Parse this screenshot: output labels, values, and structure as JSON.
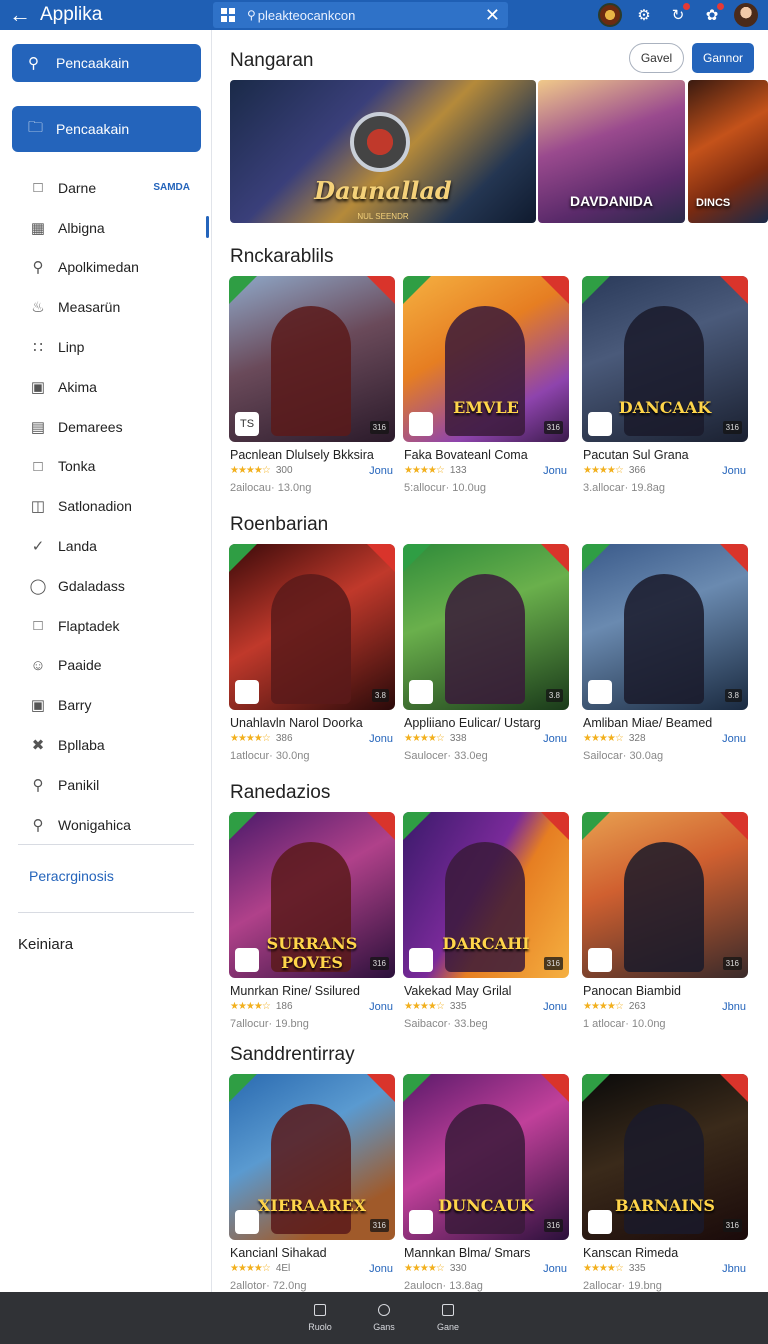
{
  "topbar": {
    "back_icon": "arrow-left-icon",
    "title": "Applika",
    "search_value": "pleakteocankcon"
  },
  "sidebar": {
    "primary_button": "Pencaakain",
    "secondary_button": "Pencaakain",
    "items": [
      {
        "label": "Darne",
        "icon": "bag-icon",
        "tag": "SAMDA"
      },
      {
        "label": "Albigna",
        "icon": "calendar-icon"
      },
      {
        "label": "Apolkimedan",
        "icon": "wrench-icon"
      },
      {
        "label": "Measarün",
        "icon": "puzzle-icon"
      },
      {
        "label": "Linp",
        "icon": "grid-dots-icon"
      },
      {
        "label": "Akima",
        "icon": "frame-icon"
      },
      {
        "label": "Demarees",
        "icon": "folder-icon"
      },
      {
        "label": "Tonka",
        "icon": "tag-icon"
      },
      {
        "label": "Satlonadion",
        "icon": "columns-icon"
      },
      {
        "label": "Landa",
        "icon": "check-icon"
      },
      {
        "label": "Gdaladass",
        "icon": "pill-icon"
      },
      {
        "label": "Flaptadek",
        "icon": "square-icon"
      },
      {
        "label": "Paaide",
        "icon": "person-icon"
      },
      {
        "label": "Barry",
        "icon": "lock-icon"
      },
      {
        "label": "Bpllaba",
        "icon": "tools-icon"
      },
      {
        "label": "Panikil",
        "icon": "search-icon"
      },
      {
        "label": "Wonigahica",
        "icon": "search-icon"
      }
    ],
    "link": "Peracrginosis",
    "section": "Keiniara"
  },
  "main": {
    "header_title": "Nangaran",
    "outline_button": "Gavel",
    "solid_button": "Gannor",
    "banners": [
      {
        "label": "Daunallad",
        "sub": "NUL SEENDR"
      },
      {
        "label": "DAVDANIDA",
        "sub": ""
      },
      {
        "label": "DINCS",
        "sub": ""
      }
    ],
    "sections": [
      {
        "title": "Rnckarablils",
        "cards": [
          {
            "name": "Pacnlean Dlulsely Bkksira",
            "count": "300",
            "link": "Jonu",
            "meta": "2ailocau· 13.0ng",
            "label": "",
            "mini": "TS",
            "rating_tag": "316"
          },
          {
            "name": "Faka Bovateanl Coma",
            "count": "133",
            "link": "Jonu",
            "meta": "5:allocur· 10.0ug",
            "label": "EMVLE",
            "mini": "",
            "rating_tag": "316"
          },
          {
            "name": "Pacutan Sul Grana",
            "count": "366",
            "link": "Jonu",
            "meta": "3.allocar· 19.8ag",
            "label": "DANCAAK",
            "mini": "",
            "rating_tag": "316"
          }
        ]
      },
      {
        "title": "Roenbarian",
        "cards": [
          {
            "name": "Unahlavln Narol Doorka",
            "count": "386",
            "link": "Jonu",
            "meta": "1atlocur· 30.0ng",
            "label": "",
            "mini": "",
            "rating_tag": "3.8"
          },
          {
            "name": "Appliiano Eulicar/ Ustarg",
            "count": "338",
            "link": "Jonu",
            "meta": "Saulocer· 33.0eg",
            "label": "",
            "mini": "",
            "rating_tag": "3.8"
          },
          {
            "name": "Amliban Miae/ Beamed",
            "count": "328",
            "link": "Jonu",
            "meta": "Sailocar· 30.0ag",
            "label": "",
            "mini": "",
            "rating_tag": "3.8"
          }
        ]
      },
      {
        "title": "Ranedazios",
        "cards": [
          {
            "name": "Munrkan Rine/ Ssilured",
            "count": "186",
            "link": "Jonu",
            "meta": "7allocur· 19.bng",
            "label": "SURRANS POVES",
            "mini": "",
            "rating_tag": "316"
          },
          {
            "name": "Vakekad May Grilal",
            "count": "335",
            "link": "Jonu",
            "meta": "Saibacor· 33.beg",
            "label": "DARCAHI",
            "mini": "",
            "rating_tag": "316"
          },
          {
            "name": "Panocan Biambid",
            "count": "263",
            "link": "Jbnu",
            "meta": "1 atlocar· 10.0ng",
            "label": "",
            "mini": "",
            "rating_tag": "316"
          }
        ]
      },
      {
        "title": "Sanddrentirray",
        "cards": [
          {
            "name": "Kancianl Sihakad",
            "count": "4El",
            "link": "Jonu",
            "meta": "2allotor· 72.0ng",
            "label": "XIERAAREX",
            "mini": "",
            "rating_tag": "316"
          },
          {
            "name": "Mannkan Blma/ Smars",
            "count": "330",
            "link": "Jonu",
            "meta": "2aulocn· 13.8ag",
            "label": "DUNCAUK",
            "mini": "",
            "rating_tag": "316"
          },
          {
            "name": "Kanscan Rimeda",
            "count": "335",
            "link": "Jbnu",
            "meta": "2allocar· 19.bng",
            "label": "BARNAINS",
            "mini": "",
            "rating_tag": "316"
          }
        ]
      }
    ]
  },
  "bottombar": {
    "items": [
      "Ruolo",
      "Gans",
      "Gane"
    ]
  },
  "colors": {
    "primary": "#2464bb",
    "topbar": "#1f5fb4",
    "bottombar": "#303236",
    "star": "#f2b01e"
  }
}
